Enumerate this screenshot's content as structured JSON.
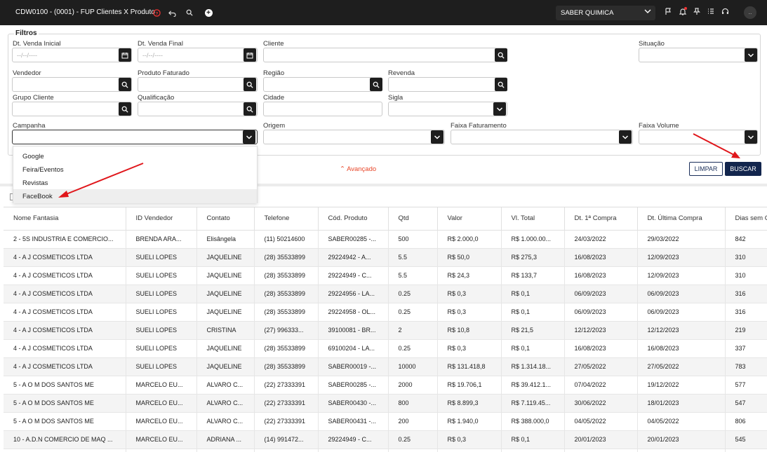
{
  "app": {
    "title": "CDW0100 - (0001) - FUP Clientes X Produto",
    "company": "SABER QUIMICA",
    "user_initial": ".."
  },
  "filters": {
    "legend": "Filtros",
    "dt_venda_inicial": {
      "label": "Dt. Venda Inicial",
      "placeholder": "--/--/----"
    },
    "dt_venda_final": {
      "label": "Dt. Venda Final",
      "placeholder": "--/--/----"
    },
    "cliente": {
      "label": "Cliente"
    },
    "situacao": {
      "label": "Situação"
    },
    "vendedor": {
      "label": "Vendedor"
    },
    "produto_faturado": {
      "label": "Produto Faturado"
    },
    "regiao": {
      "label": "Região"
    },
    "revenda": {
      "label": "Revenda"
    },
    "grupo_cliente": {
      "label": "Grupo Cliente"
    },
    "qualificacao": {
      "label": "Qualificação"
    },
    "cidade": {
      "label": "Cidade"
    },
    "sigla": {
      "label": "Sigla"
    },
    "campanha": {
      "label": "Campanha",
      "options": [
        "Google",
        "Feira/Eventos",
        "Revistas",
        "FaceBook"
      ]
    },
    "origem": {
      "label": "Origem"
    },
    "faixa_faturamento": {
      "label": "Faixa Faturamento"
    },
    "faixa_volume": {
      "label": "Faixa Volume"
    },
    "advanced": "Avançado",
    "limpar": "LIMPAR",
    "buscar": "BUSCAR"
  },
  "table": {
    "columns": [
      "Nome Fantasia",
      "ID Vendedor",
      "Contato",
      "Telefone",
      "Cód. Produto",
      "Qtd",
      "Valor",
      "Vl. Total",
      "Dt. 1ª Compra",
      "Dt. Última Compra",
      "Dias sem C"
    ],
    "rows": [
      [
        "2 - 5S INDUSTRIA E COMERCIO...",
        "BRENDA ARA...",
        "Elisângela",
        "(11) 50214600",
        "SABER00285 -...",
        "500",
        "R$ 2.000,0",
        "R$ 1.000.00...",
        "24/03/2022",
        "29/03/2022",
        "842"
      ],
      [
        "4 - A J COSMETICOS LTDA",
        "SUELI LOPES",
        "JAQUELINE",
        "(28) 35533899",
        "29224942 - A...",
        "5.5",
        "R$ 50,0",
        "R$ 275,3",
        "16/08/2023",
        "12/09/2023",
        "310"
      ],
      [
        "4 - A J COSMETICOS LTDA",
        "SUELI LOPES",
        "JAQUELINE",
        "(28) 35533899",
        "29224949 - C...",
        "5.5",
        "R$ 24,3",
        "R$ 133,7",
        "16/08/2023",
        "12/09/2023",
        "310"
      ],
      [
        "4 - A J COSMETICOS LTDA",
        "SUELI LOPES",
        "JAQUELINE",
        "(28) 35533899",
        "29224956 - LA...",
        "0.25",
        "R$ 0,3",
        "R$ 0,1",
        "06/09/2023",
        "06/09/2023",
        "316"
      ],
      [
        "4 - A J COSMETICOS LTDA",
        "SUELI LOPES",
        "JAQUELINE",
        "(28) 35533899",
        "29224958 - OL...",
        "0.25",
        "R$ 0,3",
        "R$ 0,1",
        "06/09/2023",
        "06/09/2023",
        "316"
      ],
      [
        "4 - A J COSMETICOS LTDA",
        "SUELI LOPES",
        "CRISTINA",
        "(27) 996333...",
        "39100081 - BR...",
        "2",
        "R$ 10,8",
        "R$ 21,5",
        "12/12/2023",
        "12/12/2023",
        "219"
      ],
      [
        "4 - A J COSMETICOS LTDA",
        "SUELI LOPES",
        "JAQUELINE",
        "(28) 35533899",
        "69100204 - LA...",
        "0.25",
        "R$ 0,3",
        "R$ 0,1",
        "16/08/2023",
        "16/08/2023",
        "337"
      ],
      [
        "4 - A J COSMETICOS LTDA",
        "SUELI LOPES",
        "JAQUELINE",
        "(28) 35533899",
        "SABER00019 -...",
        "10000",
        "R$ 131.418,8",
        "R$ 1.314.18...",
        "27/05/2022",
        "27/05/2022",
        "783"
      ],
      [
        "5 - A O M DOS SANTOS ME",
        "MARCELO EU...",
        "ALVARO C...",
        "(22) 27333391",
        "SABER00285 -...",
        "2000",
        "R$ 19.706,1",
        "R$ 39.412.1...",
        "07/04/2022",
        "19/12/2022",
        "577"
      ],
      [
        "5 - A O M DOS SANTOS ME",
        "MARCELO EU...",
        "ALVARO C...",
        "(22) 27333391",
        "SABER00430 -...",
        "800",
        "R$ 8.899,3",
        "R$ 7.119.45...",
        "30/06/2022",
        "18/01/2023",
        "547"
      ],
      [
        "5 - A O M DOS SANTOS ME",
        "MARCELO EU...",
        "ALVARO C...",
        "(22) 27333391",
        "SABER00431 -...",
        "200",
        "R$ 1.940,0",
        "R$ 388.000,0",
        "04/05/2022",
        "04/05/2022",
        "806"
      ],
      [
        "10 - A.D.N COMERCIO DE MAQ ...",
        "MARCELO EU...",
        "ADRIANA ...",
        "(14) 991472...",
        "29224949 - C...",
        "0.25",
        "R$ 0,3",
        "R$ 0,1",
        "20/01/2023",
        "20/01/2023",
        "545"
      ],
      [
        "",
        "",
        "",
        "",
        "",
        "",
        "",
        "",
        "",
        "",
        ""
      ]
    ]
  },
  "colors": {
    "topbar": "#1e1e1e",
    "accent_red": "#e8472a",
    "buscar": "#12254d",
    "arrow": "#e0161b"
  }
}
